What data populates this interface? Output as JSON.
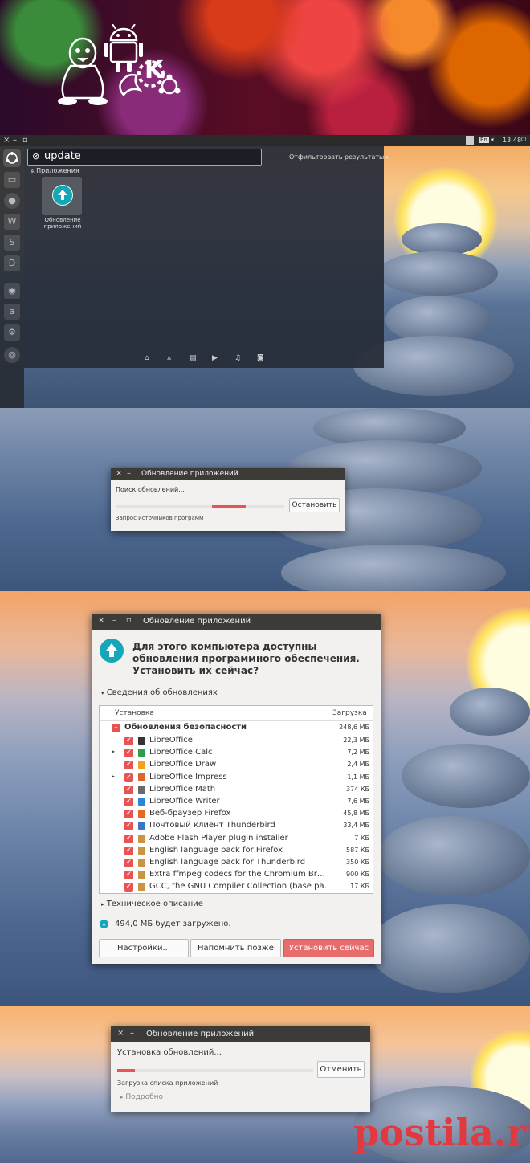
{
  "banner": {
    "logo_letter": "K"
  },
  "unity": {
    "window_controls": [
      "×",
      "–",
      "▫"
    ],
    "keyboard_layout": "En",
    "volume_icon": "speaker-icon",
    "clock": "13:48",
    "power_icon": "power-icon",
    "search_value": "update",
    "filter_label": "Отфильтровать результаты",
    "category": "Приложения",
    "result_label_line1": "Обновление",
    "result_label_line2": "приложений",
    "lens_icons": [
      "home-icon",
      "apps-icon",
      "files-icon",
      "video-icon",
      "music-icon",
      "photo-icon"
    ]
  },
  "check_dialog": {
    "title": "Обновление приложений",
    "status": "Поиск обновлений...",
    "stop_button": "Остановить",
    "substatus": "Запрос источников программ"
  },
  "main_dialog": {
    "title": "Обновление приложений",
    "heading_line1": "Для этого компьютера доступны",
    "heading_line2": "обновления программного обеспечения.",
    "heading_line3": "Установить их сейчас?",
    "details_toggle": "Сведения об обновлениях",
    "col_install": "Установка",
    "col_download": "Загрузка",
    "group": {
      "name": "Обновления безопасности",
      "size": "248,6 МБ"
    },
    "rows": [
      {
        "name": "LibreOffice",
        "size": "22,3 МБ",
        "expand": "",
        "icon_color": "#333333"
      },
      {
        "name": "LibreOffice Calc",
        "size": "7,2 МБ",
        "expand": "▸",
        "icon_color": "#2e9e4d"
      },
      {
        "name": "LibreOffice Draw",
        "size": "2,4 МБ",
        "expand": "",
        "icon_color": "#f0a21c"
      },
      {
        "name": "LibreOffice Impress",
        "size": "1,1 МБ",
        "expand": "▸",
        "icon_color": "#e0632b"
      },
      {
        "name": "LibreOffice Math",
        "size": "374 КБ",
        "expand": "",
        "icon_color": "#6a6a6a"
      },
      {
        "name": "LibreOffice Writer",
        "size": "7,6 МБ",
        "expand": "",
        "icon_color": "#2e86d0"
      },
      {
        "name": "Веб-браузер Firefox",
        "size": "45,8 МБ",
        "expand": "",
        "icon_color": "#e36b1f"
      },
      {
        "name": "Почтовый клиент Thunderbird",
        "size": "33,4 МБ",
        "expand": "",
        "icon_color": "#3b78c4"
      },
      {
        "name": "Adobe Flash Player plugin installer",
        "size": "7 КБ",
        "expand": "",
        "icon_color": "#c99545"
      },
      {
        "name": "English language pack for Firefox",
        "size": "587 КБ",
        "expand": "",
        "icon_color": "#c99545"
      },
      {
        "name": "English language pack for Thunderbird",
        "size": "350 КБ",
        "expand": "",
        "icon_color": "#c99545"
      },
      {
        "name": "Extra ffmpeg codecs for the Chromium Br…",
        "size": "900 КБ",
        "expand": "",
        "icon_color": "#c99545"
      },
      {
        "name": "GCC, the GNU Compiler Collection (base pa…",
        "size": "17 КБ",
        "expand": "",
        "icon_color": "#c99545"
      }
    ],
    "tech_toggle": "Техническое описание",
    "download_info": "494,0 МБ будет загружено.",
    "settings_button": "Настройки...",
    "remind_button": "Напомнить позже",
    "install_button": "Установить сейчас"
  },
  "install_dialog": {
    "title": "Обновление приложений",
    "status": "Установка обновлений...",
    "cancel_button": "Отменить",
    "substatus": "Загрузка списка приложений",
    "details_toggle": "Подробно"
  },
  "watermark": "postila.ru",
  "colors": {
    "accent": "#e65454",
    "titlebar": "#3c3b37",
    "update_icon": "#15a7b8"
  }
}
